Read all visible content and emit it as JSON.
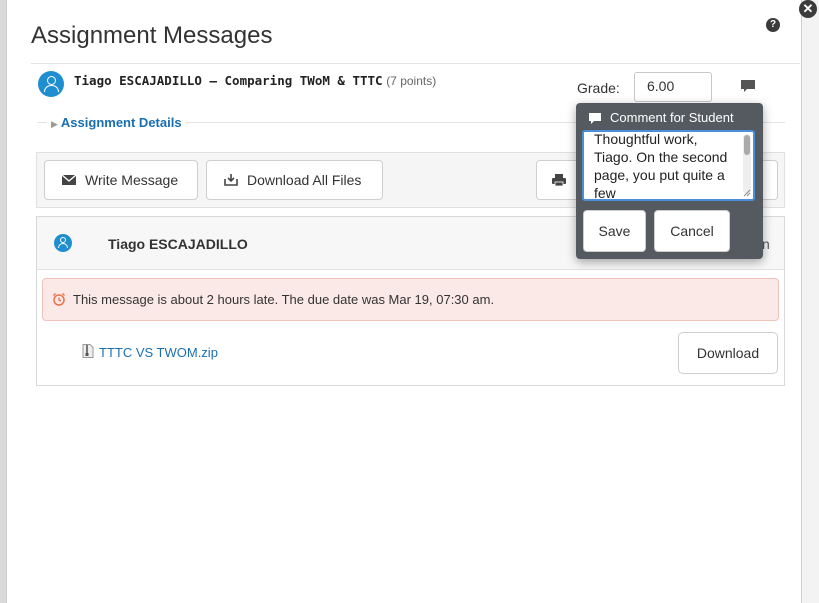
{
  "modal": {
    "title": "Assignment Messages",
    "close_glyph": "✕",
    "help_glyph": "?"
  },
  "assignment": {
    "student_name": "Tiago ESCAJADILLO",
    "separator": " – ",
    "assignment_name": "Comparing TWoM & TTTC",
    "points": "(7 points)",
    "details_link": "Assignment Details"
  },
  "grade": {
    "label": "Grade:",
    "value": "6.00"
  },
  "toolbar": {
    "write_message_label": "Write Message",
    "download_all_label": "Download All Files"
  },
  "thread": {
    "student_name": "Tiago ESCAJADILLO",
    "right_partial_text": "n",
    "late_message": "This message is about 2 hours late. The due date was Mar 19, 07:30 am.",
    "file_name": "TTTC VS TWOM.zip",
    "download_label": "Download"
  },
  "comment_popover": {
    "header": "Comment for Student",
    "text": "Thoughtful work, Tiago. On the second page, you put quite a few",
    "save_label": "Save",
    "cancel_label": "Cancel"
  },
  "colors": {
    "accent_blue": "#1f8ed1",
    "link_blue": "#1a6fb0",
    "alert_bg": "#fbe9e7",
    "alert_icon": "#e8734a",
    "popover_bg": "#555a61",
    "focus_border": "#4a90d9"
  },
  "icons": {
    "student_avatar": "person-icon",
    "comment_toggle": "speech-bubble-icon",
    "write_message": "envelope-icon",
    "download_all": "download-tray-icon",
    "print": "printer-icon",
    "late_alert": "alarm-clock-icon",
    "file": "zip-file-icon",
    "popover_header": "speech-bubble-icon"
  }
}
